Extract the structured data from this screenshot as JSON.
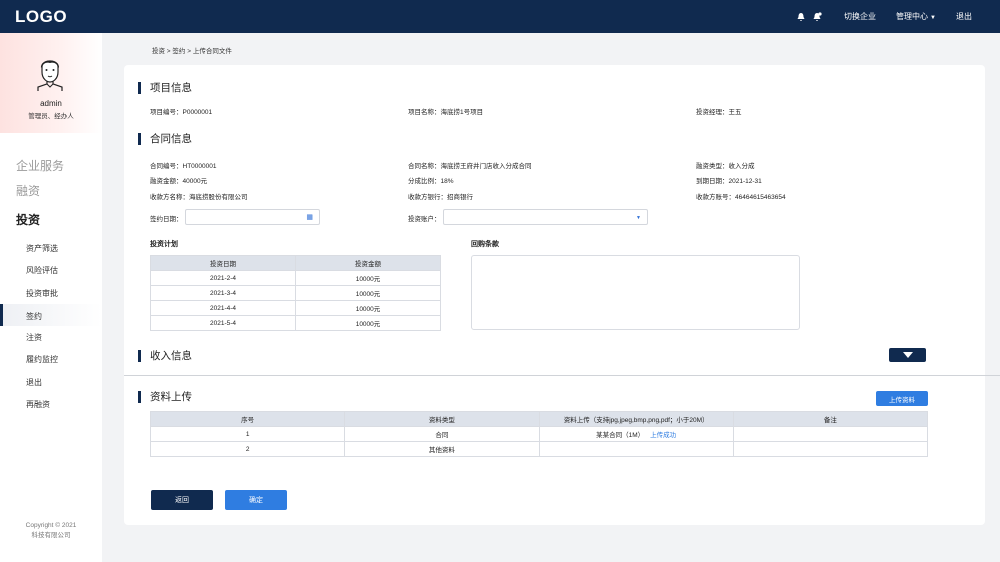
{
  "topbar": {
    "logo": "LOGO",
    "switch_company": "切换企业",
    "management_center": "管理中心",
    "logout": "退出"
  },
  "sidebar": {
    "username": "admin",
    "roles": "管理员、经办人",
    "groups": [
      "企业服务",
      "融资",
      "投资"
    ],
    "items": [
      "资产筛选",
      "风险评估",
      "投资审批",
      "签约",
      "注资",
      "履约监控",
      "退出",
      "再融资"
    ],
    "active_item": "签约",
    "copyright_line1": "Copyright © 2021",
    "copyright_line2": "科技有限公司"
  },
  "breadcrumb": "投资 > 签约 > 上传合同文件",
  "project_info": {
    "title": "项目信息",
    "fields": [
      "项目编号：P0000001",
      "项目名称：海底捞1号项目",
      "投资经理：王五"
    ]
  },
  "contract_info": {
    "title": "合同信息",
    "fields": [
      "合同编号：HT0000001",
      "合同名称：海底捞王府井门店收入分成合同",
      "融资类型：收入分成",
      "融资金额：40000元",
      "分成比例：18%",
      "到期日期：2021-12-31",
      "收款方名称：海底捞股份有限公司",
      "收款方银行：招商银行",
      "收款方账号：46464615463654"
    ],
    "sign_date_label": "签约日期：",
    "sign_date_value": "",
    "account_label": "投资账户：",
    "account_value": ""
  },
  "investment_plan": {
    "title": "投资计划",
    "columns": [
      "投资日期",
      "投资金额"
    ],
    "rows": [
      [
        "2021-2-4",
        "10000元"
      ],
      [
        "2021-3-4",
        "10000元"
      ],
      [
        "2021-4-4",
        "10000元"
      ],
      [
        "2021-5-4",
        "10000元"
      ]
    ]
  },
  "buyback": {
    "title": "回购条款",
    "value": ""
  },
  "income_info": {
    "title": "收入信息"
  },
  "upload": {
    "title": "资料上传",
    "upload_button": "上传资料",
    "columns": [
      "序号",
      "资料类型",
      "资料上传（支持jpg,jpeg,bmp,png,pdf；小于20M）",
      "备注"
    ],
    "rows": [
      {
        "index": "1",
        "type": "合同",
        "file": "某某合同（1M）",
        "status": "上传成功",
        "note": ""
      },
      {
        "index": "2",
        "type": "其他资料",
        "file": "",
        "status": "",
        "note": ""
      }
    ]
  },
  "actions": {
    "back": "返回",
    "confirm": "确定"
  },
  "colors": {
    "navy": "#102a4f",
    "blue": "#2f7de1"
  }
}
